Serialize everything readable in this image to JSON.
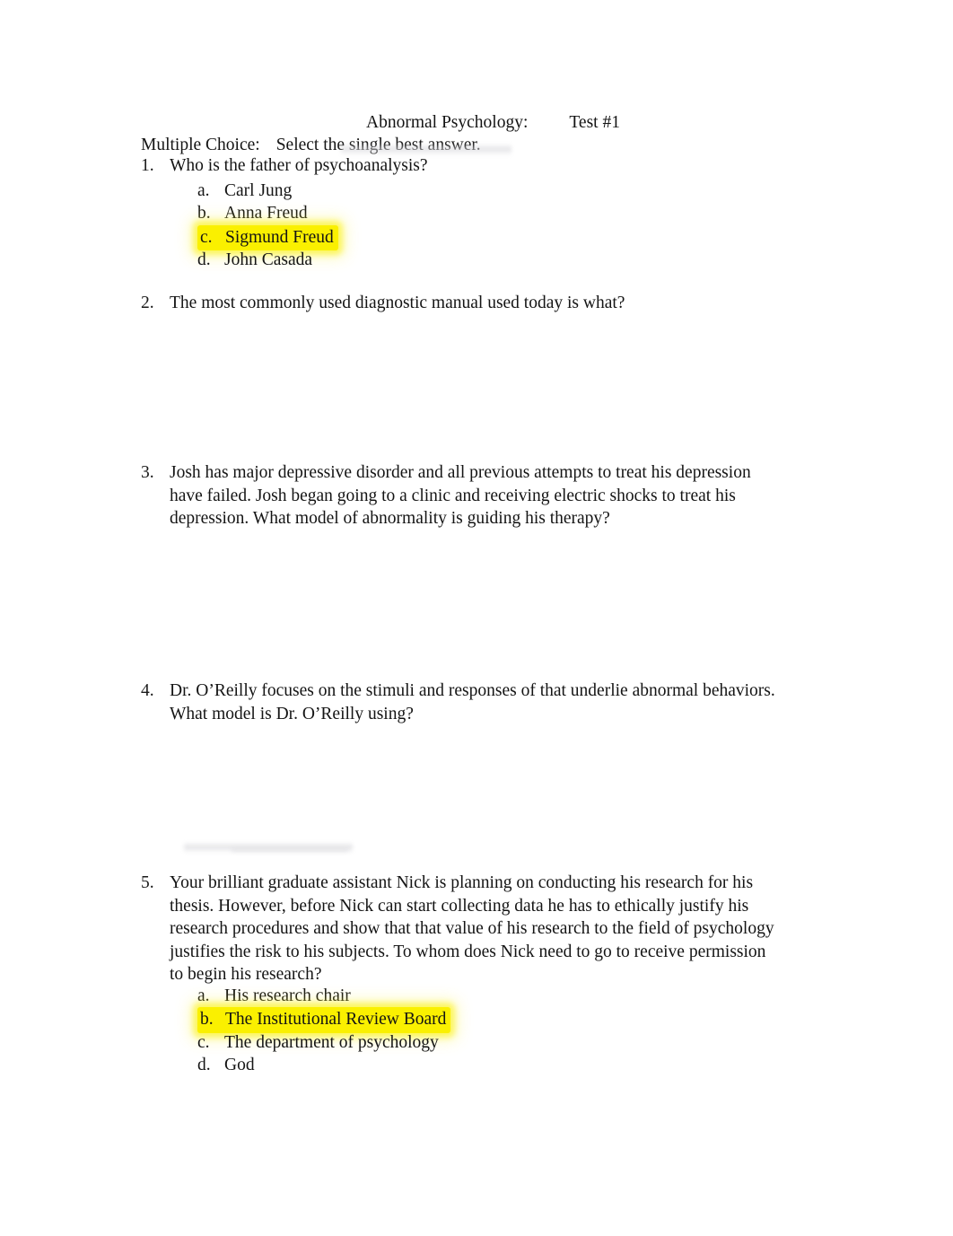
{
  "document": {
    "title_left": "Abnormal Psychology:",
    "title_right": "Test #1",
    "instructions_label": "Multiple Choice:",
    "instructions_text": "Select the single best answer.",
    "highlight_color": "#faf000",
    "text_color": "#141414",
    "page_background": "#ffffff"
  },
  "questions": [
    {
      "number": "1.",
      "text": "Who is the father of psychoanalysis?",
      "choices": [
        {
          "letter": "a.",
          "text": "Carl Jung",
          "highlighted": false
        },
        {
          "letter": "b.",
          "text": "Anna Freud",
          "highlighted": false
        },
        {
          "letter": "c.",
          "text": "Sigmund Freud",
          "highlighted": true
        },
        {
          "letter": "d.",
          "text": "John Casada",
          "highlighted": false
        }
      ]
    },
    {
      "number": "2.",
      "text": "The most commonly used diagnostic manual used today is what?",
      "choices": []
    },
    {
      "number": "3.",
      "text": "Josh has major depressive disorder and all previous attempts to treat his depression have failed. Josh began going to a clinic and receiving electric shocks to treat his depression. What model of abnormality is guiding his therapy?",
      "choices": []
    },
    {
      "number": "4.",
      "text": "Dr. O’Reilly focuses on the stimuli and responses of that underlie abnormal behaviors. What model is Dr. O’Reilly using?",
      "choices": []
    },
    {
      "number": "5.",
      "text": "Your brilliant graduate assistant Nick is planning on conducting his research for his thesis. However, before Nick can start collecting data he has to ethically justify his research procedures and show that that value of his research to the field of psychology justifies the risk to his subjects. To whom does Nick need to go to receive permission to begin his research?",
      "choices": [
        {
          "letter": "a.",
          "text": "His research chair",
          "highlighted": false
        },
        {
          "letter": "b.",
          "text": "The Institutional Review Board",
          "highlighted": true
        },
        {
          "letter": "c.",
          "text": "The department of psychology",
          "highlighted": false
        },
        {
          "letter": "d.",
          "text": "God",
          "highlighted": false
        }
      ]
    }
  ]
}
